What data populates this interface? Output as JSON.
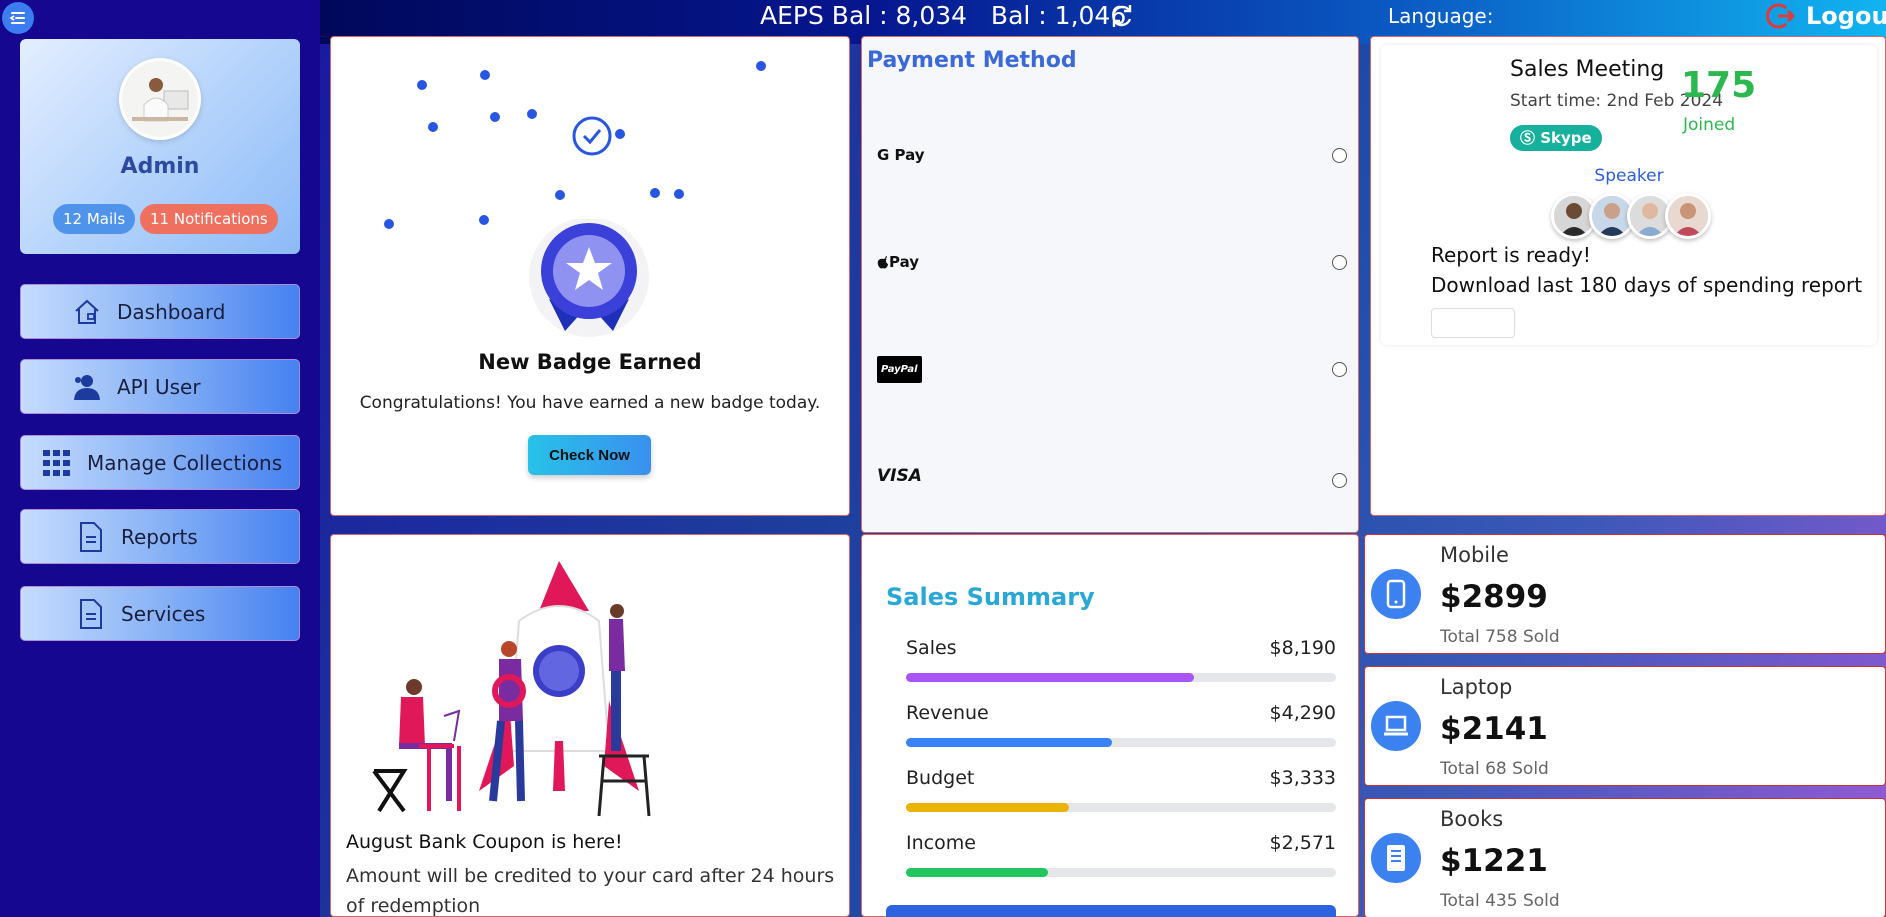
{
  "sidebar": {
    "menu_toggle_icon": "menu-collapse-icon",
    "profile": {
      "name": "Admin",
      "mails": "12 Mails",
      "notifications": "11 Notifications"
    },
    "items": [
      {
        "label": "Dashboard",
        "icon": "home-icon"
      },
      {
        "label": "API User",
        "icon": "user-icon"
      },
      {
        "label": "Manage Collections",
        "icon": "grid-icon"
      },
      {
        "label": "Reports",
        "icon": "document-icon"
      },
      {
        "label": "Services",
        "icon": "document-icon"
      }
    ]
  },
  "topbar": {
    "balance": "AEPS Bal : 8,034   Bal : 1,046",
    "refresh_icon": "refresh-icon",
    "language_label": "Language:",
    "logout_label": "Logout"
  },
  "badge_card": {
    "title": "New Badge Earned",
    "subtitle": "Congratulations! You have earned a new badge today.",
    "button": "Check Now"
  },
  "payment": {
    "title": "Payment Method",
    "methods": [
      "G Pay",
      "Pay",
      "PayPal",
      "VISA"
    ]
  },
  "meeting": {
    "title": "Sales Meeting",
    "start_time": "Start time: 2nd Feb 2024",
    "joined_count": "175",
    "joined_label": "Joined",
    "platform": "Skype",
    "speaker_label": "Speaker",
    "report_title": "Report is ready!",
    "report_desc": "Download last 180 days of spending report"
  },
  "coupon": {
    "title": "August Bank Coupon is here!",
    "desc": "Amount will be credited to your card after 24 hours of redemption"
  },
  "sales_summary": {
    "title": "Sales Summary",
    "rows": [
      {
        "label": "Sales",
        "value": "$8,190",
        "progress": 0.67,
        "color": "#a855f7"
      },
      {
        "label": "Revenue",
        "value": "$4,290",
        "progress": 0.48,
        "color": "#3b82f6"
      },
      {
        "label": "Budget",
        "value": "$3,333",
        "progress": 0.38,
        "color": "#eab308"
      },
      {
        "label": "Income",
        "value": "$2,571",
        "progress": 0.33,
        "color": "#22c55e"
      }
    ]
  },
  "stats": [
    {
      "name": "Mobile",
      "amount": "$2899",
      "sold": "Total 758 Sold",
      "icon": "mobile-icon"
    },
    {
      "name": "Laptop",
      "amount": "$2141",
      "sold": "Total 68 Sold",
      "icon": "laptop-icon"
    },
    {
      "name": "Books",
      "amount": "$1221",
      "sold": "Total 435 Sold",
      "icon": "book-icon"
    }
  ]
}
